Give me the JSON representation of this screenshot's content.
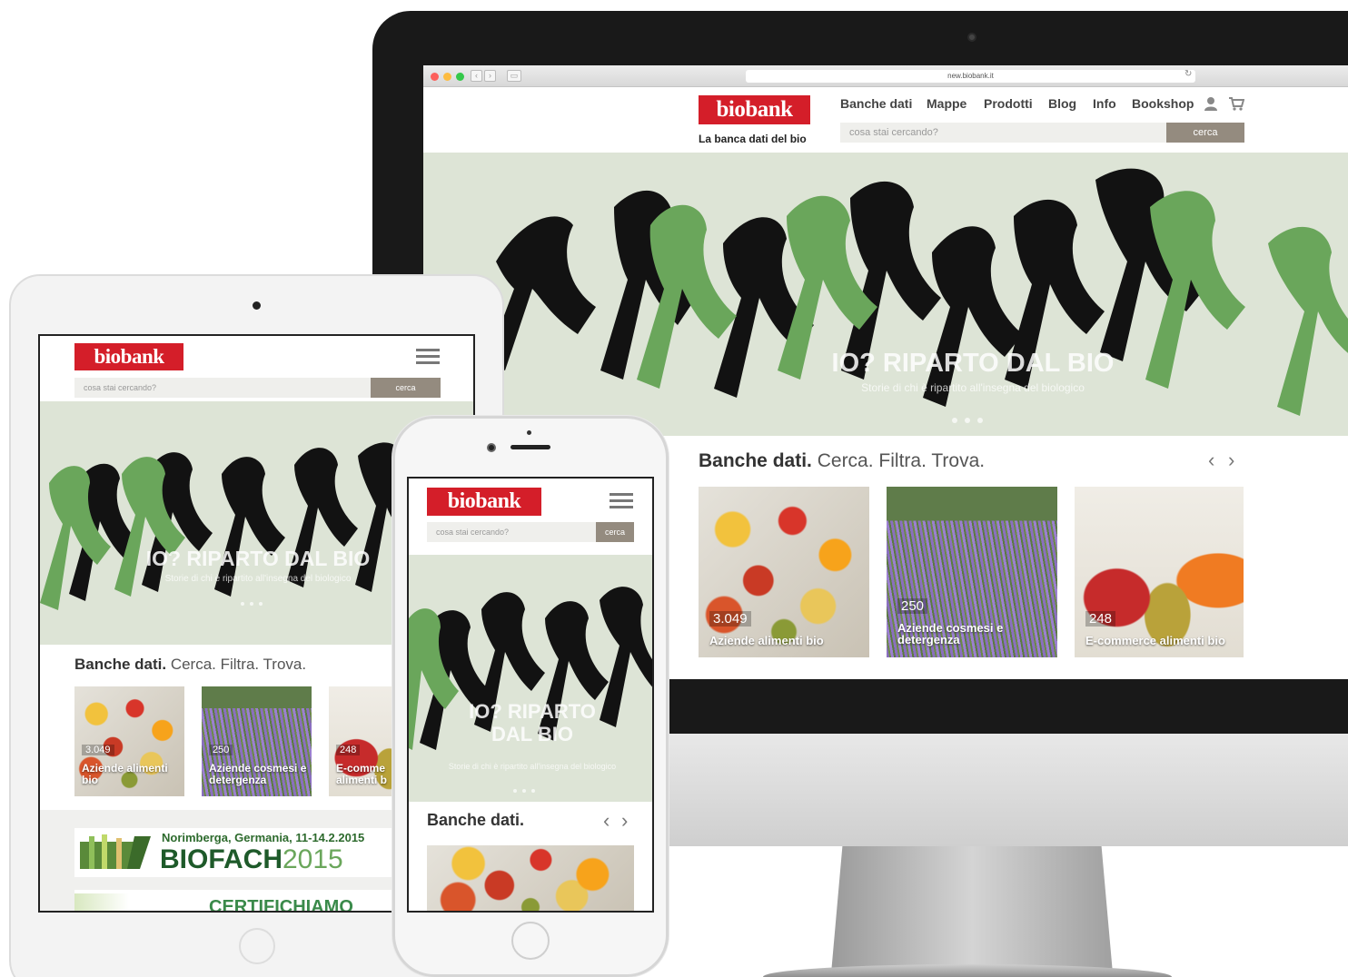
{
  "site": {
    "logo": "biobank",
    "tagline": "La banca dati del bio",
    "url": "new.biobank.it",
    "brand_color": "#d41e29"
  },
  "nav": {
    "items": [
      "Banche dati",
      "Mappe",
      "Prodotti",
      "Blog",
      "Info",
      "Bookshop"
    ],
    "icons": [
      "user-icon",
      "cart-icon"
    ]
  },
  "search": {
    "placeholder": "cosa stai cercando?",
    "button": "cerca"
  },
  "hero": {
    "title": "IO? RIPARTO DAL BIO",
    "subtitle": "Storie di chi è ripartito all'insegna del biologico",
    "phone_title_line1": "IO? RIPARTO",
    "phone_title_line2": "DAL BIO"
  },
  "section": {
    "title_bold": "Banche dati.",
    "title_rest": "Cerca. Filtra. Trova."
  },
  "cards": [
    {
      "count": "3.049",
      "label": "Aziende alimenti bio",
      "label_tablet": "Aziende alimenti bio"
    },
    {
      "count": "250",
      "label": "Aziende cosmesi e detergenza",
      "label_tablet": "Aziende cosmesi e detergenza"
    },
    {
      "count": "248",
      "label": "E-commerce alimenti bio",
      "label_tablet": "E-comme alimenti b"
    }
  ],
  "banners": {
    "biofach_line1": "Norimberga, Germania, 11-14.2.2015",
    "biofach_brand": "BIOFACH",
    "biofach_year": "2015",
    "certifichiamo": "CERTIFICHIAMO"
  }
}
